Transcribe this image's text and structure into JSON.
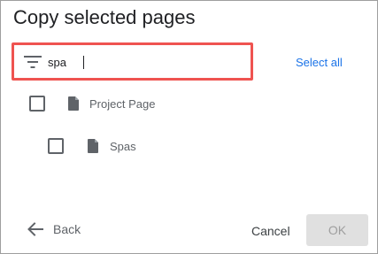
{
  "dialog": {
    "title": "Copy selected pages"
  },
  "filter": {
    "icon": "filter-icon",
    "value": "spa",
    "select_all_label": "Select all"
  },
  "items": [
    {
      "label": "Project Page",
      "icon": "document-icon",
      "checked": false
    },
    {
      "label": "Spas",
      "icon": "document-icon",
      "checked": false
    }
  ],
  "footer": {
    "back_label": "Back",
    "cancel_label": "Cancel",
    "ok_label": "OK",
    "ok_enabled": false
  },
  "colors": {
    "highlight_border": "#ef5350",
    "link": "#1a73e8",
    "disabled_button_bg": "#e0e0e0"
  }
}
